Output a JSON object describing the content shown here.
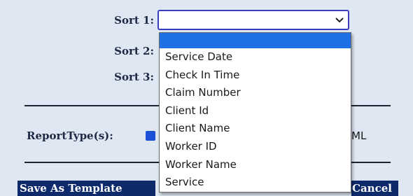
{
  "sort_labels": [
    "Sort 1:",
    "Sort 2:",
    "Sort 3:"
  ],
  "sort1": {
    "selected_value": ""
  },
  "dropdown": {
    "options": [
      "",
      "Service Date",
      "Check In Time",
      "Claim Number",
      "Client Id",
      "Client Name",
      "Worker ID",
      "Worker Name",
      "Service"
    ],
    "highlighted_index": 0
  },
  "report_type": {
    "label": "ReportType(s):",
    "partial_text": "ML",
    "checked": true
  },
  "buttons": {
    "save_template": "Save As Template",
    "cancel": "Cancel"
  },
  "colors": {
    "background": "#dfe7f3",
    "button_bg": "#0f2a6b",
    "highlight": "#1f6fe6"
  }
}
